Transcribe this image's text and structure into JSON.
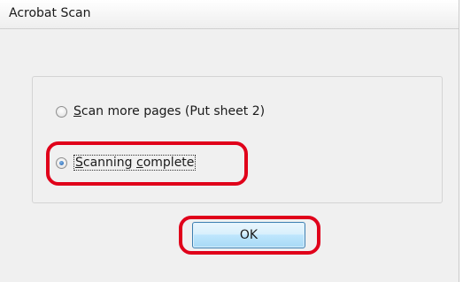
{
  "window": {
    "title": "Acrobat Scan"
  },
  "options": [
    {
      "mnemonic": "S",
      "rest": "can more pages (Put sheet 2)",
      "checked": false
    },
    {
      "mnemonic": "S",
      "rest": "canning ",
      "mnemonic2": "c",
      "rest2": "omplete",
      "checked": true
    }
  ],
  "buttons": {
    "ok_label": "OK"
  },
  "annotation_color": "#e0001a"
}
